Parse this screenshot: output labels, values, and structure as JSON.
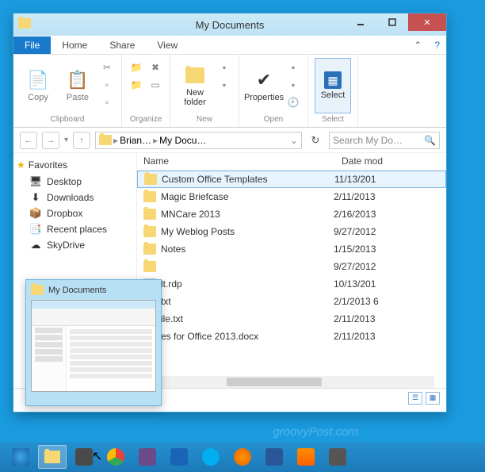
{
  "window": {
    "title": "My Documents",
    "tabs": {
      "file": "File",
      "home": "Home",
      "share": "Share",
      "view": "View"
    }
  },
  "ribbon": {
    "clipboard": {
      "label": "Clipboard",
      "copy": "Copy",
      "paste": "Paste"
    },
    "organize": {
      "label": "Organize"
    },
    "new": {
      "label": "New",
      "newfolder": "New\nfolder"
    },
    "open": {
      "label": "Open",
      "properties": "Properties"
    },
    "select": {
      "label": "Select",
      "select": "Select"
    }
  },
  "address": {
    "crumbs": [
      "Brian…",
      "My Docu…"
    ],
    "search_placeholder": "Search My Do…"
  },
  "sidebar": {
    "header": "Favorites",
    "items": [
      {
        "label": "Desktop",
        "icon": "desktop"
      },
      {
        "label": "Downloads",
        "icon": "downloads"
      },
      {
        "label": "Dropbox",
        "icon": "dropbox"
      },
      {
        "label": "Recent places",
        "icon": "recent"
      },
      {
        "label": "SkyDrive",
        "icon": "skydrive"
      }
    ]
  },
  "columns": {
    "name": "Name",
    "date": "Date mod"
  },
  "files": [
    {
      "name": "Custom Office Templates",
      "date": "11/13/201",
      "type": "folder",
      "selected": true
    },
    {
      "name": "Magic Briefcase",
      "date": "2/11/2013",
      "type": "folder"
    },
    {
      "name": "MNCare 2013",
      "date": "2/16/2013",
      "type": "folder"
    },
    {
      "name": "My Weblog Posts",
      "date": "9/27/2012",
      "type": "folder"
    },
    {
      "name": "Notes",
      "date": "1/15/2013",
      "type": "folder"
    },
    {
      "name": "",
      "date": "9/27/2012",
      "type": "folder"
    },
    {
      "name": "lt.rdp",
      "date": "10/13/201",
      "type": "file"
    },
    {
      "name": "txt",
      "date": "2/1/2013 6",
      "type": "file"
    },
    {
      "name": "ile.txt",
      "date": "2/11/2013",
      "type": "file"
    },
    {
      "name": "es for Office 2013.docx",
      "date": "2/11/2013",
      "type": "file"
    }
  ],
  "preview": {
    "title": "My Documents"
  },
  "watermark": "groovyPost.com"
}
